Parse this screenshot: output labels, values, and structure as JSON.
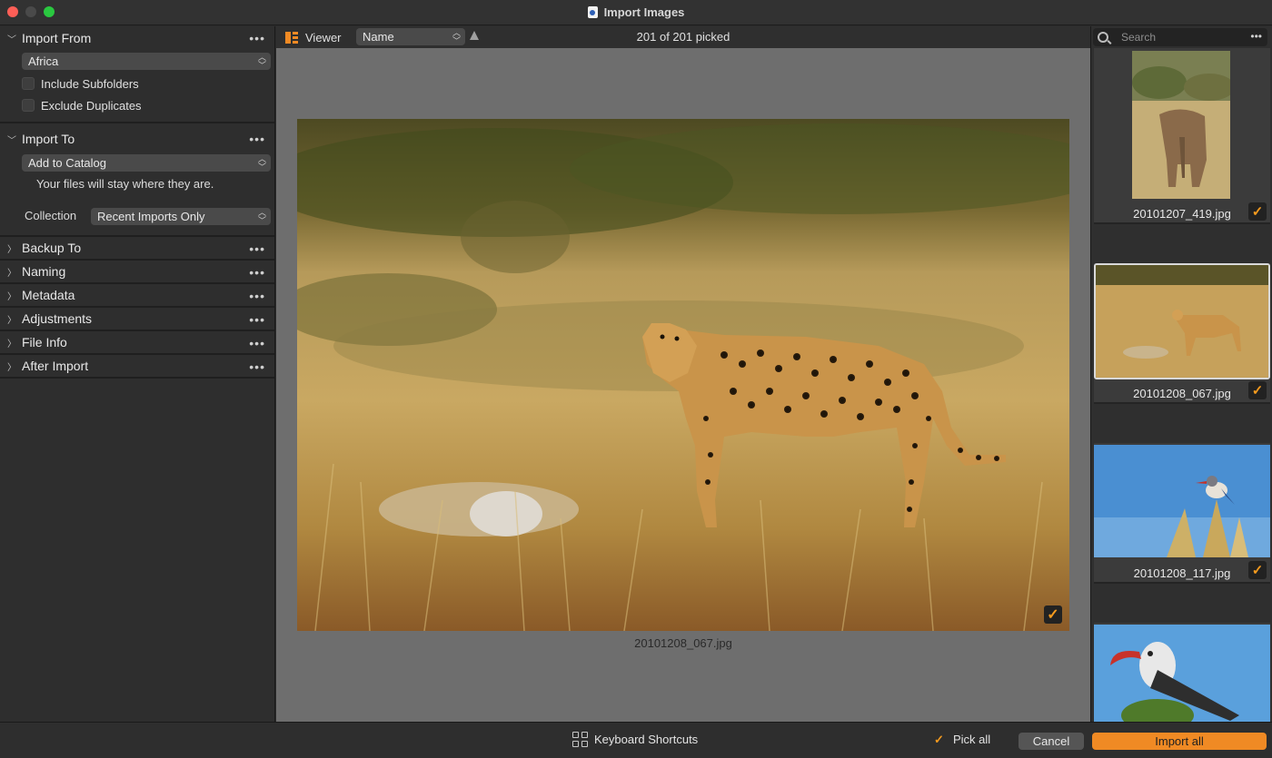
{
  "window": {
    "title": "Import Images"
  },
  "left": {
    "import_from": {
      "title": "Import From",
      "source": "Africa",
      "include_subfolders": "Include Subfolders",
      "exclude_duplicates": "Exclude Duplicates"
    },
    "import_to": {
      "title": "Import To",
      "destination": "Add to Catalog",
      "note": "Your files will stay where they are.",
      "collection_label": "Collection",
      "collection_value": "Recent Imports Only"
    },
    "sections": [
      "Backup To",
      "Naming",
      "Metadata",
      "Adjustments",
      "File Info",
      "After Import"
    ]
  },
  "toolbar": {
    "viewer_label": "Viewer",
    "sort_by": "Name",
    "picked_status": "201 of 201 picked"
  },
  "viewer": {
    "filename": "20101208_067.jpg"
  },
  "filmstrip": {
    "search_placeholder": "Search",
    "items": [
      {
        "filename": "20101207_419.jpg",
        "picked": true
      },
      {
        "filename": "20101208_067.jpg",
        "picked": true,
        "selected": true
      },
      {
        "filename": "20101208_117.jpg",
        "picked": true
      }
    ]
  },
  "bottom": {
    "keyboard_shortcuts": "Keyboard Shortcuts",
    "pick_all": "Pick all",
    "cancel": "Cancel",
    "import_all": "Import all"
  },
  "colors": {
    "accent": "#f08a24",
    "viewer_bg": "#6e6e6e",
    "panel_bg": "#2e2e2e"
  }
}
